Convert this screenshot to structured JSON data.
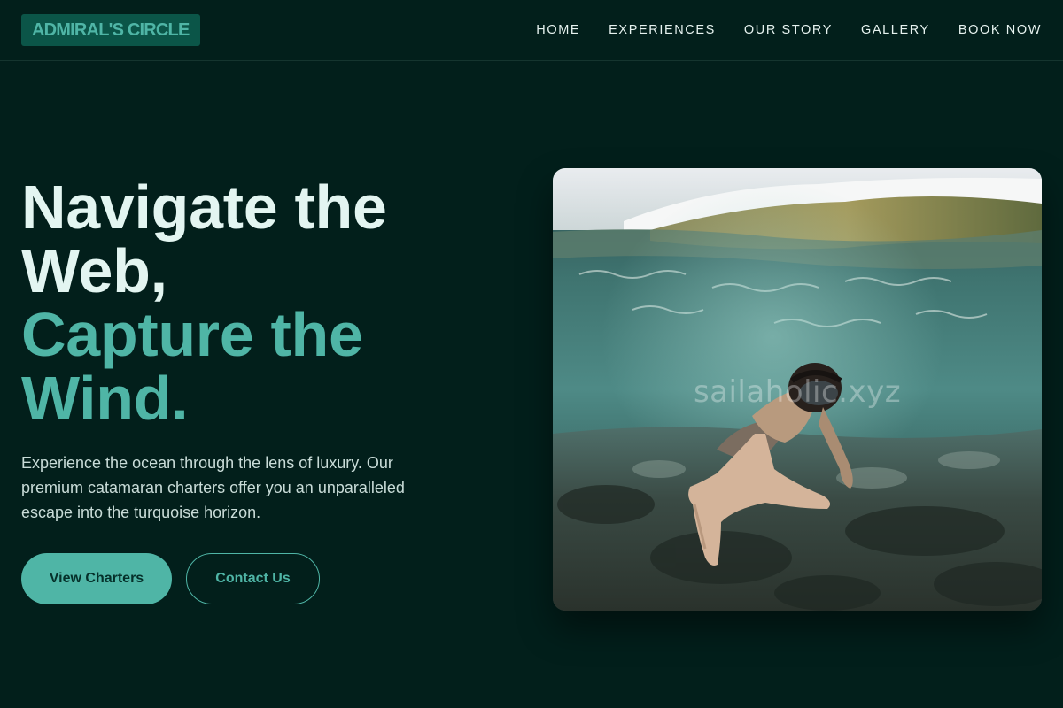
{
  "brand": {
    "name": "ADMIRAL'S CIRCLE"
  },
  "nav": {
    "items": [
      {
        "label": "HOME"
      },
      {
        "label": "EXPERIENCES"
      },
      {
        "label": "OUR STORY"
      },
      {
        "label": "GALLERY"
      },
      {
        "label": "BOOK NOW"
      }
    ]
  },
  "hero": {
    "headline_line1": "Navigate the",
    "headline_line2": "Web,",
    "accent_line1": "Capture the",
    "accent_line2": "Wind.",
    "description": "Experience the ocean through the lens of luxury. Our premium catamaran charters offer you an unparalleled escape into the turquoise horizon.",
    "primary_cta": "View Charters",
    "secondary_cta": "Contact Us",
    "image_watermark": "sailaholic.xyz"
  },
  "colors": {
    "background": "#021f1b",
    "accent": "#4fb5a6",
    "headline": "#e3f5f1"
  }
}
